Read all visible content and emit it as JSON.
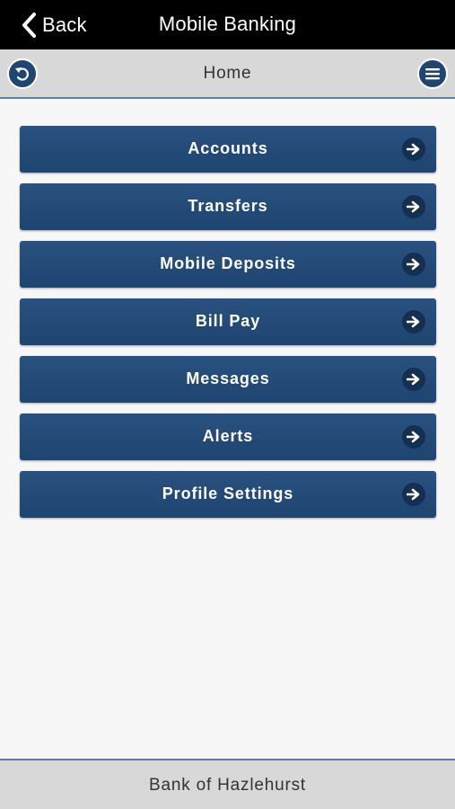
{
  "topbar": {
    "back_label": "Back",
    "title": "Mobile Banking"
  },
  "subheader": {
    "title": "Home",
    "left_icon": "undo-icon",
    "right_icon": "menu-icon"
  },
  "menu": {
    "items": [
      {
        "label": "Accounts"
      },
      {
        "label": "Transfers"
      },
      {
        "label": "Mobile Deposits"
      },
      {
        "label": "Bill Pay"
      },
      {
        "label": "Messages"
      },
      {
        "label": "Alerts"
      },
      {
        "label": "Profile Settings"
      }
    ]
  },
  "footer": {
    "text": "Bank of Hazlehurst"
  },
  "colors": {
    "accent": "#1f4572",
    "topbar": "#000000",
    "header_bg": "#d8d8d8",
    "divider": "#5d7fa0"
  }
}
